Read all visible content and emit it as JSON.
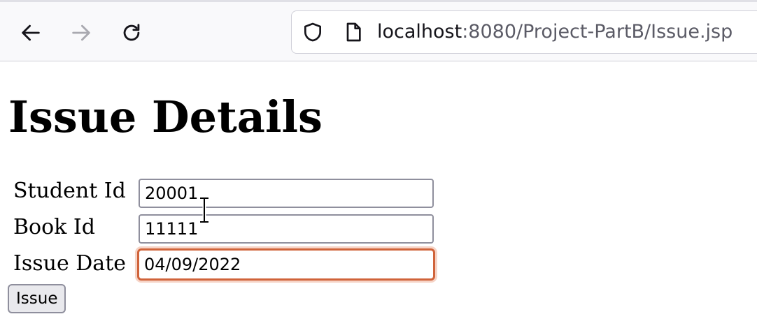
{
  "browser": {
    "url_host": "localhost",
    "url_rest": ":8080/Project-PartB/Issue.jsp",
    "icons": {
      "back": "back-arrow-icon",
      "forward": "forward-arrow-icon",
      "reload": "reload-icon",
      "site_security": "shield-icon",
      "page": "page-icon"
    }
  },
  "page": {
    "title": "Issue Details",
    "form": {
      "student_id_label": "Student Id",
      "student_id_value": "20001",
      "book_id_label": "Book Id",
      "book_id_value": "11111",
      "issue_date_label": "Issue Date",
      "issue_date_value": "04/09/2022",
      "submit_label": "Issue"
    }
  },
  "colors": {
    "focus_border": "#d0633a",
    "focus_ring": "#f6d4c7",
    "input_border": "#8f8f9d",
    "button_bg": "#e9e9ed"
  }
}
